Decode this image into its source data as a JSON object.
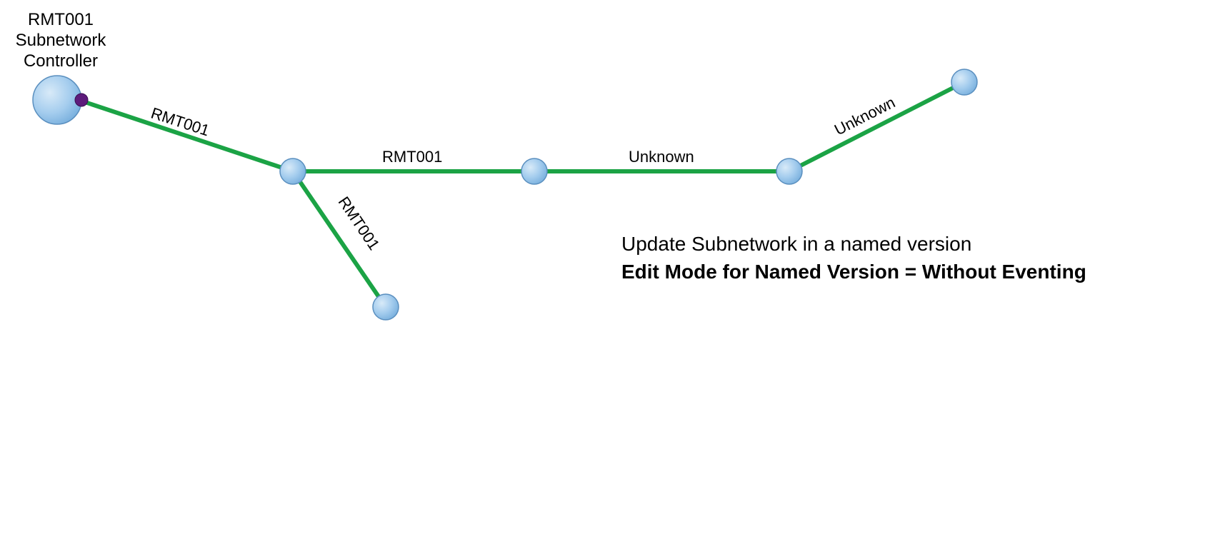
{
  "nodes": {
    "controller": {
      "label_lines": [
        "RMT001",
        "Subnetwork",
        "Controller"
      ]
    }
  },
  "edges": {
    "e1": {
      "label": "RMT001"
    },
    "e2": {
      "label": "RMT001"
    },
    "e3": {
      "label": "RMT001"
    },
    "e4": {
      "label": "Unknown"
    },
    "e5": {
      "label": "Unknown"
    }
  },
  "caption": {
    "line1": "Update Subnetwork in a named version",
    "line2": "Edit Mode for Named Version = Without Eventing"
  },
  "colors": {
    "edge": "#1ba345",
    "node_fill_light": "#cfe5f7",
    "node_fill_dark": "#8fc0e8",
    "node_stroke": "#5a8fbf",
    "marker": "#5d1b7b"
  }
}
